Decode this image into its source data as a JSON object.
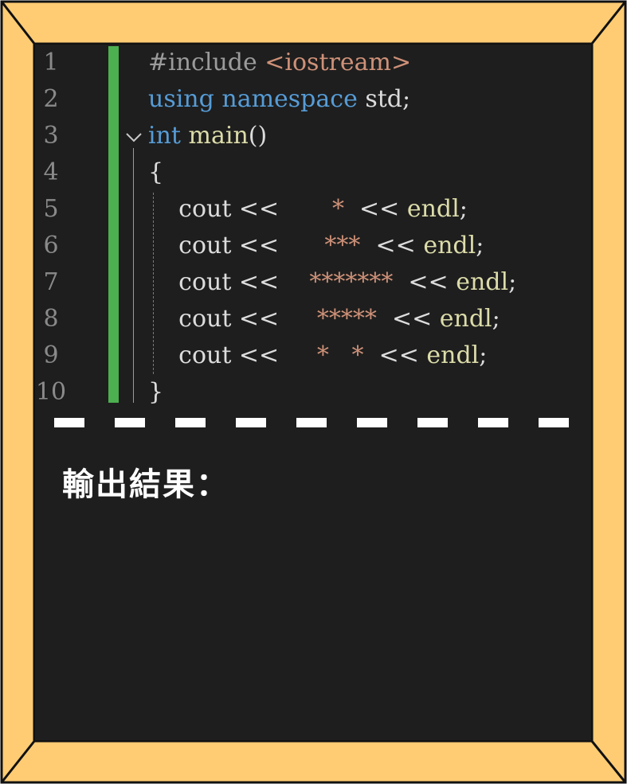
{
  "editor": {
    "lines": [
      {
        "num": "1",
        "parts": [
          {
            "cls": "pp",
            "text": "#include "
          },
          {
            "cls": "str",
            "text": "<iostream>"
          }
        ]
      },
      {
        "num": "2",
        "parts": [
          {
            "cls": "kw",
            "text": "using namespace "
          },
          {
            "cls": "plain",
            "text": "std;"
          }
        ]
      },
      {
        "num": "3",
        "parts": [
          {
            "cls": "kw",
            "text": "int "
          },
          {
            "cls": "fn",
            "text": "main"
          },
          {
            "cls": "plain",
            "text": "()"
          }
        ]
      },
      {
        "num": "4",
        "parts": [
          {
            "cls": "plain",
            "text": "{"
          }
        ]
      },
      {
        "num": "5",
        "parts": [
          {
            "cls": "plain",
            "text": "    cout << "
          },
          {
            "cls": "str",
            "text": "      *  "
          },
          {
            "cls": "plain",
            "text": "<< "
          },
          {
            "cls": "fn",
            "text": "endl"
          },
          {
            "cls": "plain",
            "text": ";"
          }
        ]
      },
      {
        "num": "6",
        "parts": [
          {
            "cls": "plain",
            "text": "    cout << "
          },
          {
            "cls": "str",
            "text": "     ***  "
          },
          {
            "cls": "plain",
            "text": "<< "
          },
          {
            "cls": "fn",
            "text": "endl"
          },
          {
            "cls": "plain",
            "text": ";"
          }
        ]
      },
      {
        "num": "7",
        "parts": [
          {
            "cls": "plain",
            "text": "    cout << "
          },
          {
            "cls": "str",
            "text": "   *******  "
          },
          {
            "cls": "plain",
            "text": "<< "
          },
          {
            "cls": "fn",
            "text": "endl"
          },
          {
            "cls": "plain",
            "text": ";"
          }
        ]
      },
      {
        "num": "8",
        "parts": [
          {
            "cls": "plain",
            "text": "    cout << "
          },
          {
            "cls": "str",
            "text": "    *****  "
          },
          {
            "cls": "plain",
            "text": "<< "
          },
          {
            "cls": "fn",
            "text": "endl"
          },
          {
            "cls": "plain",
            "text": ";"
          }
        ]
      },
      {
        "num": "9",
        "parts": [
          {
            "cls": "plain",
            "text": "    cout << "
          },
          {
            "cls": "str",
            "text": "    *   *  "
          },
          {
            "cls": "plain",
            "text": "<< "
          },
          {
            "cls": "fn",
            "text": "endl"
          },
          {
            "cls": "plain",
            "text": ";"
          }
        ]
      },
      {
        "num": "10",
        "parts": [
          {
            "cls": "plain",
            "text": "}"
          }
        ]
      }
    ],
    "fold_icon": "chevron-down-icon"
  },
  "output": {
    "label": "輸出結果："
  },
  "colors": {
    "frame": "#ffcc73",
    "screen": "#1e1e1e",
    "gutter_bar": "#4caf50",
    "keyword": "#569cd6",
    "string": "#ce9178",
    "function": "#dcdcaa"
  }
}
